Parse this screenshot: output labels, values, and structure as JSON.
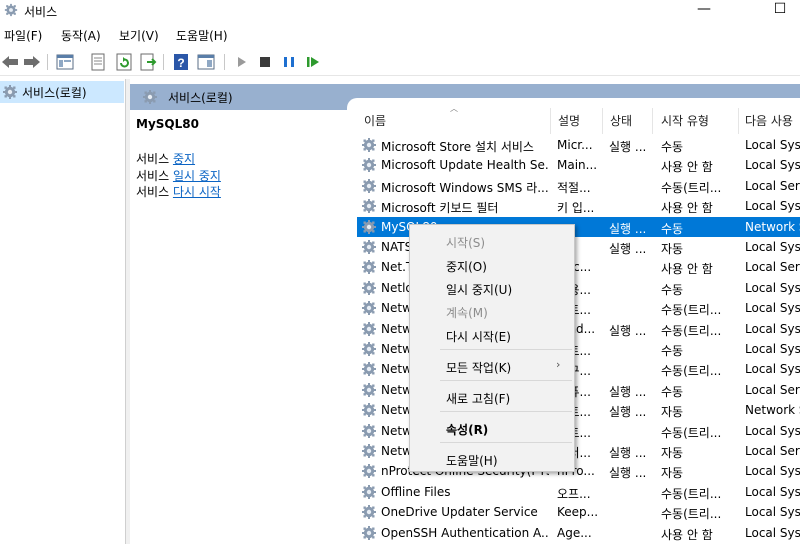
{
  "window": {
    "title": "서비스",
    "minimize": "—",
    "maximize": "☐"
  },
  "menu": [
    "파일(F)",
    "동작(A)",
    "보기(V)",
    "도움말(H)"
  ],
  "tree": {
    "root_label": "서비스(로컬)"
  },
  "header": {
    "label": "서비스(로컬)"
  },
  "description": {
    "service_name": "MySQL80",
    "actions": [
      {
        "prefix": "서비스 ",
        "link": "중지"
      },
      {
        "prefix": "서비스 ",
        "link": "일시 중지"
      },
      {
        "prefix": "서비스 ",
        "link": "다시 시작"
      }
    ]
  },
  "columns": [
    "이름",
    "설명",
    "상태",
    "시작 유형",
    "다음 사용"
  ],
  "rows": [
    {
      "name": "Microsoft Store 설치 서비스",
      "desc": "Micr...",
      "status": "실행 ...",
      "startup": "수동",
      "logon": "Local Syst"
    },
    {
      "name": "Microsoft Update Health Se...",
      "desc": "Main...",
      "status": "",
      "startup": "사용 안 함",
      "logon": "Local Syst"
    },
    {
      "name": "Microsoft Windows SMS 라...",
      "desc": "적절...",
      "status": "",
      "startup": "수동(트리...",
      "logon": "Local Serv"
    },
    {
      "name": "Microsoft 키보드 필터",
      "desc": "키 입...",
      "status": "",
      "startup": "사용 안 함",
      "logon": "Local Syst"
    },
    {
      "name": "MySQL80",
      "desc": "",
      "status": "실행 ...",
      "startup": "수동",
      "logon": "Network S",
      "selected": true
    },
    {
      "name": "NATS",
      "desc": "",
      "status": "실행 ...",
      "startup": "자동",
      "logon": "Local Syst"
    },
    {
      "name": "Net.T",
      "desc": "...tc...",
      "status": "",
      "startup": "사용 안 함",
      "logon": "Local Serv"
    },
    {
      "name": "Netlo",
      "desc": "...용...",
      "status": "",
      "startup": "수동",
      "logon": "Local Syst"
    },
    {
      "name": "Netw",
      "desc": "...트...",
      "status": "",
      "startup": "수동(트리...",
      "logon": "Local Syst"
    },
    {
      "name": "Netw",
      "desc": "...nd...",
      "status": "실행 ...",
      "startup": "수동(트리...",
      "logon": "Local Syst"
    },
    {
      "name": "Netw",
      "desc": "...트...",
      "status": "",
      "startup": "수동",
      "logon": "Local Syst"
    },
    {
      "name": "Netw",
      "desc": "...구...",
      "status": "",
      "startup": "수동(트리...",
      "logon": "Local Syst"
    },
    {
      "name": "Netw",
      "desc": "...퓨...",
      "status": "실행 ...",
      "startup": "수동",
      "logon": "Local Serv"
    },
    {
      "name": "Netw",
      "desc": "...트...",
      "status": "실행 ...",
      "startup": "자동",
      "logon": "Network S"
    },
    {
      "name": "Netw",
      "desc": "...트...",
      "status": "",
      "startup": "수동(트리...",
      "logon": "Local Syst"
    },
    {
      "name": "Netw",
      "desc": "...서...",
      "status": "실행 ...",
      "startup": "자동",
      "logon": "Local Serv"
    },
    {
      "name": "nProtect Online Security(PTS)",
      "desc": "nPro...",
      "status": "실행 ...",
      "startup": "자동",
      "logon": "Local Syst"
    },
    {
      "name": "Offline Files",
      "desc": "오프...",
      "status": "",
      "startup": "수동(트리...",
      "logon": "Local Syst"
    },
    {
      "name": "OneDrive Updater Service",
      "desc": "Keep...",
      "status": "",
      "startup": "수동(트리...",
      "logon": "Local Syst"
    },
    {
      "name": "OpenSSH Authentication A...",
      "desc": "Age...",
      "status": "",
      "startup": "사용 안 함",
      "logon": "Local Syst"
    }
  ],
  "context_menu": {
    "start": "시작(S)",
    "stop": "중지(O)",
    "pause": "일시 중지(U)",
    "resume": "계속(M)",
    "restart": "다시 시작(E)",
    "all_tasks": "모든 작업(K)",
    "refresh": "새로 고침(F)",
    "properties": "속성(R)",
    "help": "도움말(H)",
    "submenu_arrow": "›"
  },
  "colors": {
    "selection": "#0078d7",
    "header_band": "#98b0cf",
    "tree_selection": "#cce8ff",
    "link": "#0b64c4"
  }
}
